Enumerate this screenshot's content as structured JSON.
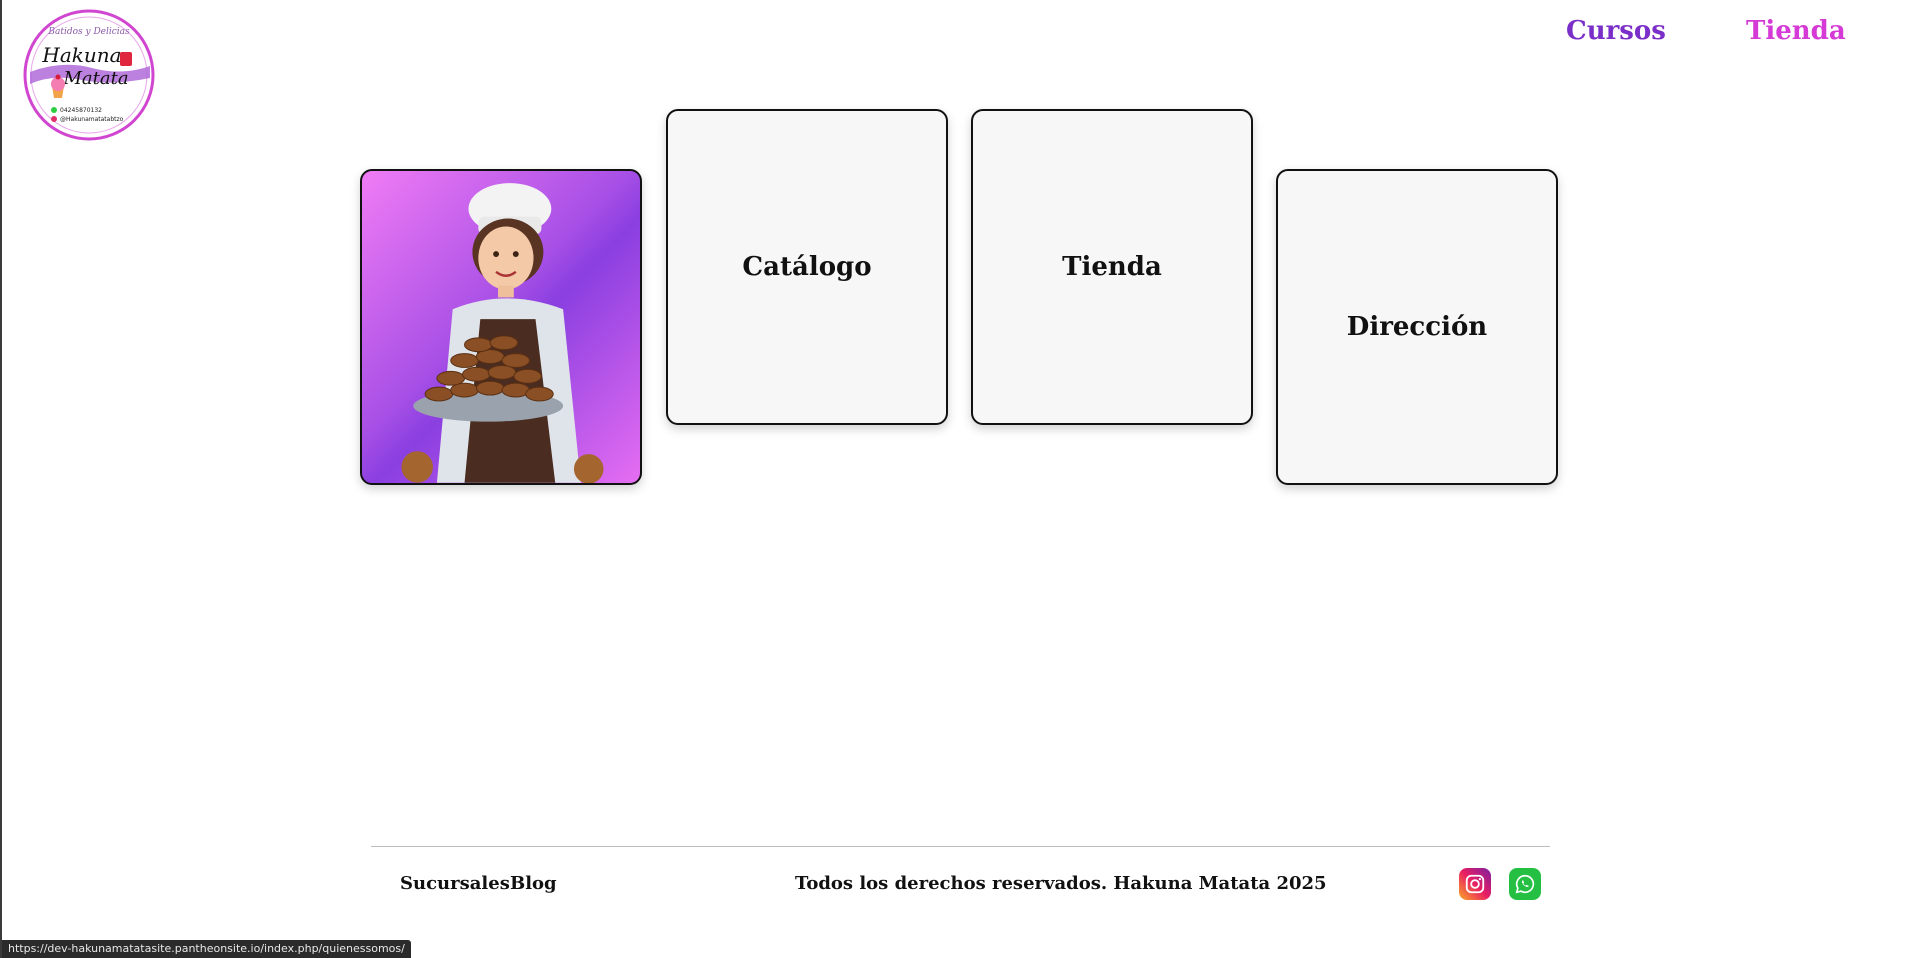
{
  "logo": {
    "brand_line1": "Hakuna",
    "brand_line2": "Matata",
    "tagline": "Batidos y Delicias",
    "phone": "04245870132",
    "handle": "@Hakunamatatabtzo",
    "icon": "cupcake-icon"
  },
  "nav": {
    "cursos": "Cursos",
    "tienda": "Tienda",
    "colors": {
      "cursos": "#7b2fc9",
      "tienda": "#d63ad6"
    }
  },
  "cards": {
    "image_alt": "baker-illustration",
    "catalogo": "Catálogo",
    "tienda": "Tienda",
    "direccion": "Dirección"
  },
  "footer": {
    "sucursales": "Sucursales",
    "blog": "Blog",
    "copyright": "Todos los derechos reservados. Hakuna Matata 2025",
    "social": [
      "instagram-icon",
      "whatsapp-icon"
    ]
  },
  "status_bar": {
    "url": "https://dev-hakunamatatasite.pantheonsite.io/index.php/quienessomos/"
  }
}
